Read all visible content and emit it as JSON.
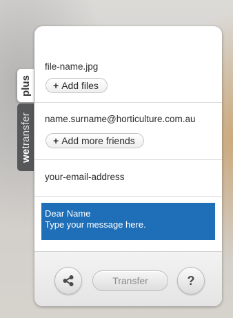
{
  "side_tabs": {
    "plus_label": "plus",
    "brand_bold": "we",
    "brand_rest": "transfer"
  },
  "files": {
    "file_name": "file-name.jpg",
    "add_files_plus": "+",
    "add_files_label": "Add files"
  },
  "friends": {
    "recipient_email": "name.surname@horticulture.com.au",
    "add_friends_plus": "+",
    "add_friends_label": "Add more friends"
  },
  "sender": {
    "email_placeholder": "your-email-address"
  },
  "message": {
    "line1": "Dear Name",
    "line2": "Type your message here."
  },
  "footer": {
    "share_icon": "share-icon",
    "transfer_label": "Transfer",
    "help_label": "?"
  },
  "colors": {
    "message_bg": "#1f6fb8",
    "brand_tab_bg": "#555759"
  }
}
